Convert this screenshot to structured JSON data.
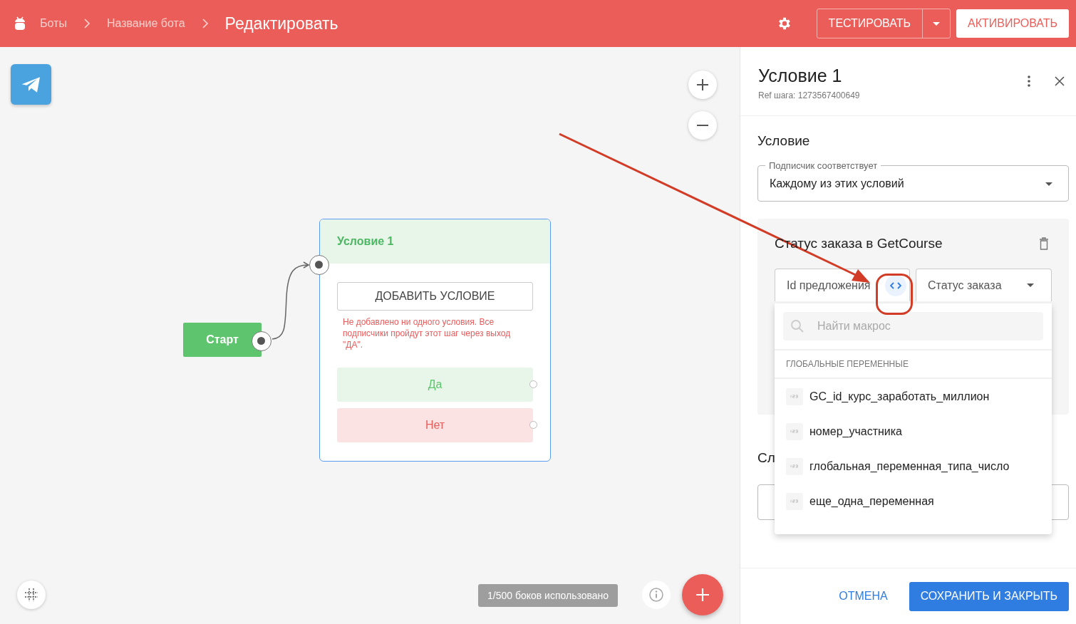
{
  "header": {
    "breadcrumbs": [
      {
        "label": "Боты",
        "kind": "link"
      },
      {
        "label": "Название бота",
        "kind": "link"
      },
      {
        "label": "Редактировать",
        "kind": "current"
      }
    ],
    "test_button": "ТЕСТИРОВАТЬ",
    "activate_button": "АКТИВИРОВАТЬ"
  },
  "canvas": {
    "start_node": {
      "label": "Старт"
    },
    "condition_node": {
      "title": "Условие 1",
      "add_button": "ДОБАВИТЬ УСЛОВИЕ",
      "warning": "Не добавлено ни одного условия. Все подписчики пройдут этот шаг через выход \"ДА\".",
      "outputs": [
        {
          "label": "Да",
          "kind": "yes"
        },
        {
          "label": "Нет",
          "kind": "no"
        }
      ]
    },
    "counter": "1/500 боков использовано"
  },
  "panel": {
    "title": "Условие 1",
    "ref": "Ref шага: 1273567400649",
    "section_title": "Условие",
    "match_field": {
      "label": "Подписчик соответствует",
      "value": "Каждому из этих условий"
    },
    "condition_card": {
      "title": "Статус заказа в GetCourse",
      "left_field": "Id предложения",
      "right_field": "Статус заказа"
    },
    "macro_menu": {
      "placeholder": "Найти макрос",
      "section": "ГЛОБАЛЬНЫЕ ПЕРЕМЕННЫЕ",
      "items": [
        {
          "label": "GC_id_курс_заработать_миллион"
        },
        {
          "label": "номер_участника"
        },
        {
          "label": "глобальная_переменная_типа_число"
        },
        {
          "label": "еще_одна_переменная"
        }
      ]
    },
    "next_section": {
      "title": "Сл"
    },
    "cancel_button": "ОТМЕНА",
    "save_button": "СОХРАНИТЬ И ЗАКРЫТЬ"
  }
}
